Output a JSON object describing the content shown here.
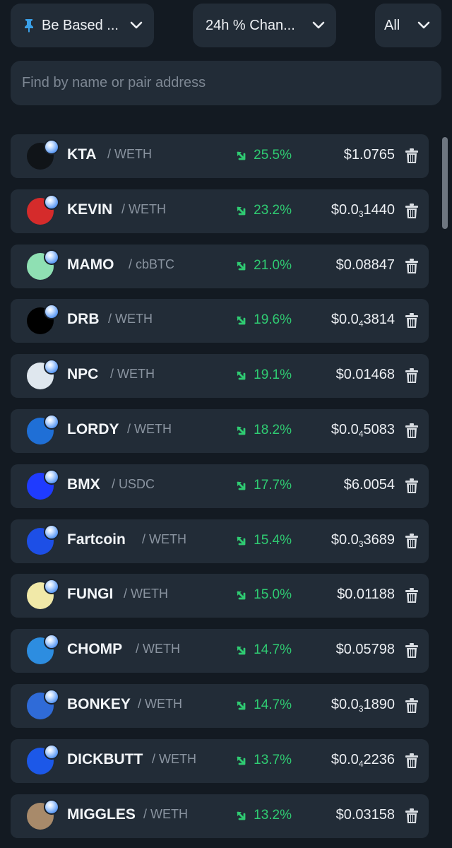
{
  "filters": {
    "pinned_label": "Be Based ...",
    "sort_label": "24h % Chan...",
    "range_label": "All"
  },
  "search": {
    "placeholder": "Find by name or pair address"
  },
  "colors": {
    "background": "#131a22",
    "card": "#222c37",
    "positive": "#2fcb72",
    "muted": "#8a94a0"
  },
  "tokens": [
    {
      "symbol": "KTA",
      "pair": "/ WETH",
      "change": "25.5%",
      "price": "$1.0765",
      "price_prefix": "",
      "price_sub": "",
      "price_suffix": "",
      "icon": "kta-logo",
      "icon_color": "#101418"
    },
    {
      "symbol": "KEVIN",
      "pair": "/ WETH",
      "change": "23.2%",
      "price": "",
      "price_prefix": "$0.0",
      "price_sub": "3",
      "price_suffix": "1440",
      "icon": "kevin-logo",
      "icon_color": "#d52b2b"
    },
    {
      "symbol": "MAMO",
      "pair": "/ cbBTC",
      "change": "21.0%",
      "price": "$0.08847",
      "price_prefix": "",
      "price_sub": "",
      "price_suffix": "",
      "icon": "mamo-logo",
      "icon_color": "#8fe0b3"
    },
    {
      "symbol": "DRB",
      "pair": "/ WETH",
      "change": "19.6%",
      "price": "",
      "price_prefix": "$0.0",
      "price_sub": "4",
      "price_suffix": "3814",
      "icon": "drb-logo",
      "icon_color": "#000000"
    },
    {
      "symbol": "NPC",
      "pair": "/ WETH",
      "change": "19.1%",
      "price": "$0.01468",
      "price_prefix": "",
      "price_sub": "",
      "price_suffix": "",
      "icon": "npc-logo",
      "icon_color": "#dfe7ee"
    },
    {
      "symbol": "LORDY",
      "pair": "/ WETH",
      "change": "18.2%",
      "price": "",
      "price_prefix": "$0.0",
      "price_sub": "4",
      "price_suffix": "5083",
      "icon": "lordy-logo",
      "icon_color": "#1f6fd6"
    },
    {
      "symbol": "BMX",
      "pair": "/ USDC",
      "change": "17.7%",
      "price": "$6.0054",
      "price_prefix": "",
      "price_sub": "",
      "price_suffix": "",
      "icon": "bmx-logo",
      "icon_color": "#1f3bff"
    },
    {
      "symbol": "Fartcoin",
      "pair": "/ WETH",
      "change": "15.4%",
      "price": "",
      "price_prefix": "$0.0",
      "price_sub": "3",
      "price_suffix": "3689",
      "icon": "fartcoin-logo",
      "icon_color": "#1d4fe6"
    },
    {
      "symbol": "FUNGI",
      "pair": "/ WETH",
      "change": "15.0%",
      "price": "$0.01188",
      "price_prefix": "",
      "price_sub": "",
      "price_suffix": "",
      "icon": "fungi-logo",
      "icon_color": "#f1e9a8"
    },
    {
      "symbol": "CHOMP",
      "pair": "/ WETH",
      "change": "14.7%",
      "price": "$0.05798",
      "price_prefix": "",
      "price_sub": "",
      "price_suffix": "",
      "icon": "chomp-logo",
      "icon_color": "#2d8de0"
    },
    {
      "symbol": "BONKEY",
      "pair": "/ WETH",
      "change": "14.7%",
      "price": "",
      "price_prefix": "$0.0",
      "price_sub": "3",
      "price_suffix": "1890",
      "icon": "bonkey-logo",
      "icon_color": "#2f6bd8"
    },
    {
      "symbol": "DICKBUTT",
      "pair": "/ WETH",
      "change": "13.7%",
      "price": "",
      "price_prefix": "$0.0",
      "price_sub": "4",
      "price_suffix": "2236",
      "icon": "dickbutt-logo",
      "icon_color": "#1c58e8"
    },
    {
      "symbol": "MIGGLES",
      "pair": "/ WETH",
      "change": "13.2%",
      "price": "$0.03158",
      "price_prefix": "",
      "price_sub": "",
      "price_suffix": "",
      "icon": "miggles-logo",
      "icon_color": "#a88a6a"
    }
  ]
}
